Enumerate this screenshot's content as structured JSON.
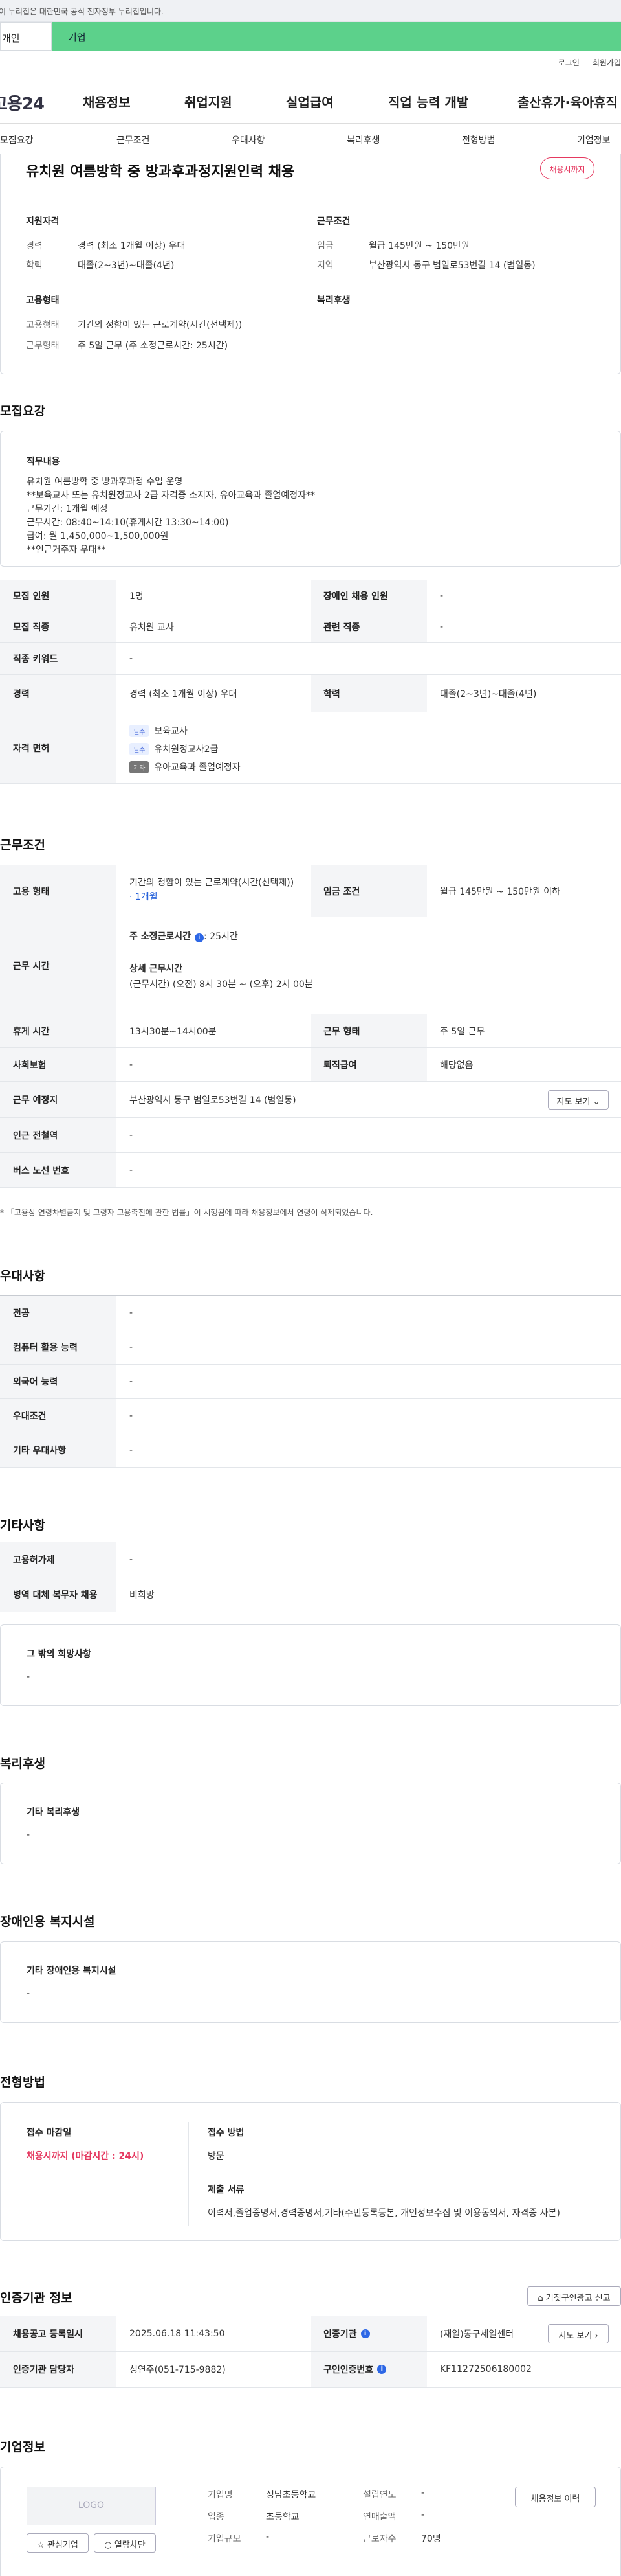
{
  "gov_banner": "이 누리집은 대한민국 공식 전자정부 누리집입니다.",
  "user_tabs": [
    "개인",
    "기업"
  ],
  "top_links": [
    "로그인",
    "회원가입"
  ],
  "logo": "고용24",
  "gnb": [
    "채용정보",
    "취업지원",
    "실업급여",
    "직업 능력 개발",
    "출산휴가·육아휴직"
  ],
  "subnav": [
    "모집요강",
    "근무조건",
    "우대사항",
    "복리후생",
    "전형방법",
    "기업정보"
  ],
  "job": {
    "title": "유치원 여름방학 중 방과후과정지원인력 채용",
    "status": "채용시까지",
    "qual_title": "지원자격",
    "work_title": "근무조건",
    "career_k": "경력",
    "career_v": "경력 (최소 1개월 이상) 우대",
    "edu_k": "학력",
    "edu_v": "대졸(2~3년)~대졸(4년)",
    "wage_k": "임금",
    "wage_v": "월급 145만원 ~ 150만원",
    "region_k": "지역",
    "region_v": "부산광역시 동구 범일로53번길 14 (범일동)",
    "emp_title": "고용형태",
    "welfare_title": "복리후생",
    "emptype_k": "고용형태",
    "emptype_v": "기간의 정함이 있는 근로계약(시간(선택제))",
    "workform_k": "근무형태",
    "workform_v": "주 5일 근무 (주 소정근로시간: 25시간)"
  },
  "recruit": {
    "heading": "모집요강",
    "duty_title": "직무내용",
    "duty_text": "유치원 여름방학 중 방과후과정 수업 운영\n**보육교사 또는 유치원정교사 2급 자격증 소지자, 유아교육과 졸업예정자**\n근무기간: 1개월 예정\n근무시간: 08:40~14:10(휴게시간 13:30~14:00)\n급여: 월 1,450,000~1,500,000원\n**인근거주자 우대**",
    "rows": {
      "headcount_k": "모집 인원",
      "headcount_v": "1명",
      "disabled_k": "장애인 채용 인원",
      "disabled_v": "-",
      "jobtype_k": "모집 직종",
      "jobtype_v": "유치원 교사",
      "related_k": "관련 직종",
      "related_v": "-",
      "keyword_k": "직종 키워드",
      "keyword_v": "-",
      "career_k": "경력",
      "career_v": "경력 (최소 1개월 이상) 우대",
      "edu_k": "학력",
      "edu_v": "대졸(2~3년)~대졸(4년)",
      "license_k": "자격 면허",
      "licenses": [
        {
          "tag": "필수",
          "name": "보육교사"
        },
        {
          "tag": "필수",
          "name": "유치원정교사2급"
        },
        {
          "tag": "기타",
          "name": "유아교육과 졸업예정자"
        }
      ]
    }
  },
  "conditions": {
    "heading": "근무조건",
    "emptype_k": "고용 형태",
    "emptype_v": "기간의 정함이 있는 근로계약(시간(선택제))",
    "emptype_sub": "· 1개월",
    "wage_k": "임금 조건",
    "wage_v": "월급 145만원 ~ 150만원 이하",
    "hours_k": "근무 시간",
    "hours_title": "주 소정근로시간",
    "hours_v": ": 25시간",
    "detail_title": "상세 근무시간",
    "detail_v": "(근무시간) (오전) 8시 30분 ~ (오후) 2시 00분",
    "break_k": "휴게 시간",
    "break_v": "13시30분~14시00분",
    "form_k": "근무 형태",
    "form_v": "주 5일 근무",
    "ins_k": "사회보험",
    "ins_v": "-",
    "retire_k": "퇴직급여",
    "retire_v": "해당없음",
    "place_k": "근무 예정지",
    "place_v": "부산광역시 동구 범일로53번길 14 (범일동)",
    "map_btn": "지도 보기",
    "subway_k": "인근 전철역",
    "subway_v": "-",
    "bus_k": "버스 노선 번호",
    "bus_v": "-",
    "note": "* 「고용상 연령차별금지 및 고령자 고용촉진에 관한 법률」이 시행됨에 따라 채용정보에서 연령이 삭제되었습니다."
  },
  "prefer": {
    "heading": "우대사항",
    "rows": [
      [
        "전공",
        "-"
      ],
      [
        "컴퓨터 활용 능력",
        "-"
      ],
      [
        "외국어 능력",
        "-"
      ],
      [
        "우대조건",
        "-"
      ],
      [
        "기타 우대사항",
        "-"
      ]
    ]
  },
  "etc": {
    "heading": "기타사항",
    "rows": [
      [
        "고용허가제",
        "-"
      ],
      [
        "병역 대체 복무자 채용",
        "비희망"
      ]
    ],
    "other_title": "그 밖의 희망사항",
    "other_v": "-"
  },
  "welfare": {
    "heading": "복리후생",
    "title": "기타 복리후생",
    "v": "-"
  },
  "disability": {
    "heading": "장애인용 복지시설",
    "title": "기타 장애인용 복지시설",
    "v": "-"
  },
  "screening": {
    "heading": "전형방법",
    "deadline_title": "접수 마감일",
    "deadline_v": "채용시까지 (마감시간 : 24시)",
    "method_title": "접수 방법",
    "method_v": "방문",
    "docs_title": "제출 서류",
    "docs_v": "이력서,졸업증명서,경력증명서,기타(주민등록등본, 개인정보수집 및 이용동의서, 자격증 사본)"
  },
  "cert": {
    "heading": "인증기관 정보",
    "report_btn": "거짓구인광고 신고",
    "reg_k": "채용공고 등록일시",
    "reg_v": "2025.06.18 11:43:50",
    "org_k": "인증기관",
    "org_v": "(재일)동구세일센터",
    "map_btn": "지도 보기",
    "mgr_k": "인증기관 담당자",
    "mgr_v": "성연주(051-715-9882)",
    "no_k": "구인인증번호",
    "no_v": "KF11272506180002"
  },
  "company": {
    "heading": "기업정보",
    "logo": "LOGO",
    "fav_btn": "관심기업",
    "block_btn": "열람차단",
    "hist_btn": "채용정보 이력",
    "name_k": "기업명",
    "name_v": "성남초등학교",
    "year_k": "설립연도",
    "year_v": "-",
    "ind_k": "업종",
    "ind_v": "초등학교",
    "sales_k": "연매출액",
    "sales_v": "-",
    "size_k": "기업규모",
    "size_v": "-",
    "emp_k": "근로자수",
    "emp_v": "70명"
  },
  "colors": {
    "accent_green": "#5cd18b",
    "status_red": "#e53960",
    "link_blue": "#1f5cd9"
  }
}
